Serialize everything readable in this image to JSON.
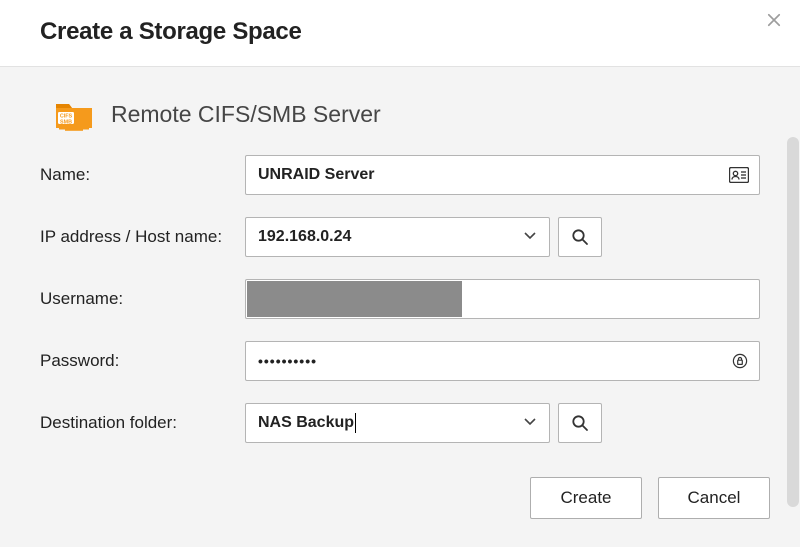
{
  "header": {
    "title": "Create a Storage Space"
  },
  "section": {
    "title": "Remote CIFS/SMB Server",
    "folder_badge_line1": "CIFS",
    "folder_badge_line2": "SMB"
  },
  "form": {
    "name_label": "Name:",
    "name_value": "UNRAID Server",
    "ip_label": "IP address / Host name:",
    "ip_value": "192.168.0.24",
    "username_label": "Username:",
    "username_value": "",
    "password_label": "Password:",
    "password_mask": "••••••••••",
    "dest_label": "Destination folder:",
    "dest_value": "NAS Backup"
  },
  "buttons": {
    "create": "Create",
    "cancel": "Cancel"
  }
}
